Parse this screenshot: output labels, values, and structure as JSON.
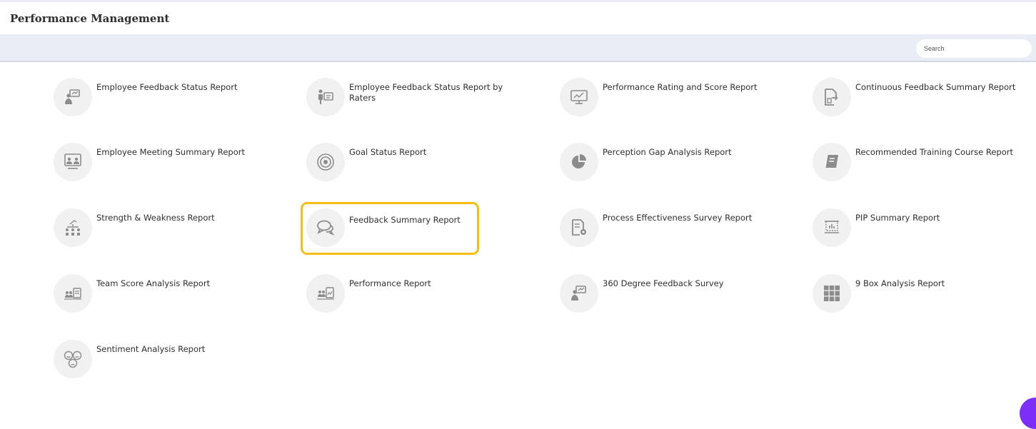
{
  "header": {
    "title": "Performance Management"
  },
  "toolbar": {
    "search_placeholder": "Search"
  },
  "reports": [
    {
      "label": "Employee Feedback Status Report",
      "icon": "presentation-person-icon"
    },
    {
      "label": "Employee Feedback Status Report by Raters",
      "icon": "rater-board-icon"
    },
    {
      "label": "Performance Rating and Score Report",
      "icon": "monitor-chart-icon"
    },
    {
      "label": "Continuous Feedback Summary Report",
      "icon": "document-export-icon"
    },
    {
      "label": "Employee Meeting Summary Report",
      "icon": "meeting-board-icon"
    },
    {
      "label": "Goal Status Report",
      "icon": "target-icon"
    },
    {
      "label": "Perception Gap Analysis Report",
      "icon": "pie-chart-icon"
    },
    {
      "label": "Recommended Training Course Report",
      "icon": "book-icon"
    },
    {
      "label": "Strength & Weakness Report",
      "icon": "org-growth-icon"
    },
    {
      "label": "Feedback Summary Report",
      "icon": "chat-bubbles-icon",
      "selected": true
    },
    {
      "label": "Process Effectiveness Survey Report",
      "icon": "document-gear-icon"
    },
    {
      "label": "PIP Summary Report",
      "icon": "easel-chart-icon"
    },
    {
      "label": "Team Score Analysis Report",
      "icon": "team-score-icon"
    },
    {
      "label": "Performance Report",
      "icon": "team-report-icon"
    },
    {
      "label": "360 Degree Feedback Survey",
      "icon": "presentation-person-icon"
    },
    {
      "label": "9 Box Analysis Report",
      "icon": "nine-box-grid-icon"
    },
    {
      "label": "Sentiment Analysis Report",
      "icon": "emotion-faces-icon"
    }
  ],
  "colors": {
    "toolbar_bg": "#e9edf6",
    "icon_circle": "#f1f1f1",
    "selection_outline": "#f2bf16",
    "icon_stroke": "#8c8c8c",
    "chat_fab": "#7b2ff7"
  }
}
